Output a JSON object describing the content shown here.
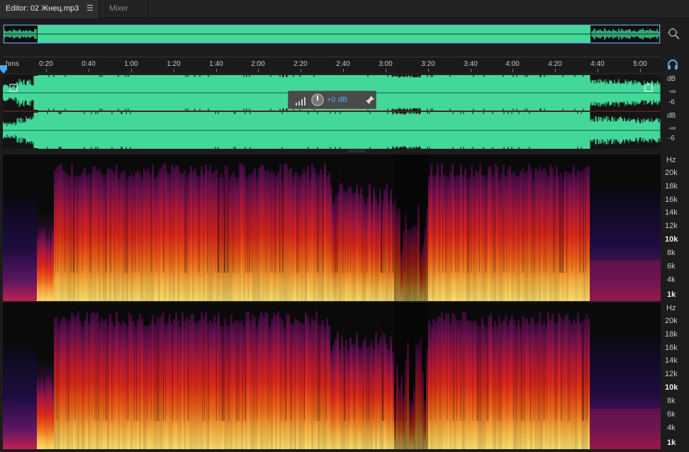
{
  "tabs": {
    "editor_label": "Editor: 02 Жнец.mp3",
    "editor_menu": "☰",
    "mixer_label": "Mixer"
  },
  "ruler": {
    "unit": "hms",
    "ticks": [
      "0:20",
      "0:40",
      "1:00",
      "1:20",
      "1:40",
      "2:00",
      "2:20",
      "2:40",
      "3:00",
      "3:20",
      "3:40",
      "4:00",
      "4:20",
      "4:40",
      "5:00"
    ]
  },
  "waveform": {
    "db_labels": [
      "dB",
      "-∞",
      "-6",
      "dB",
      "-∞",
      "-6"
    ],
    "fill_color": "#43d89a",
    "hud": {
      "gain": "+0 dB"
    }
  },
  "spectral": {
    "hz_labels": [
      "Hz",
      "20k",
      "18k",
      "16k",
      "14k",
      "12k",
      "10k",
      "8k",
      "6k",
      "4k",
      "1k"
    ]
  },
  "colors": {
    "accent": "#4ea8f0",
    "waveform": "#43d89a"
  },
  "icons": [
    "menu-icon",
    "zoom-icon",
    "playhead-icon",
    "headphone-icon",
    "level-meter-icon",
    "gain-knob-icon",
    "pin-icon"
  ]
}
